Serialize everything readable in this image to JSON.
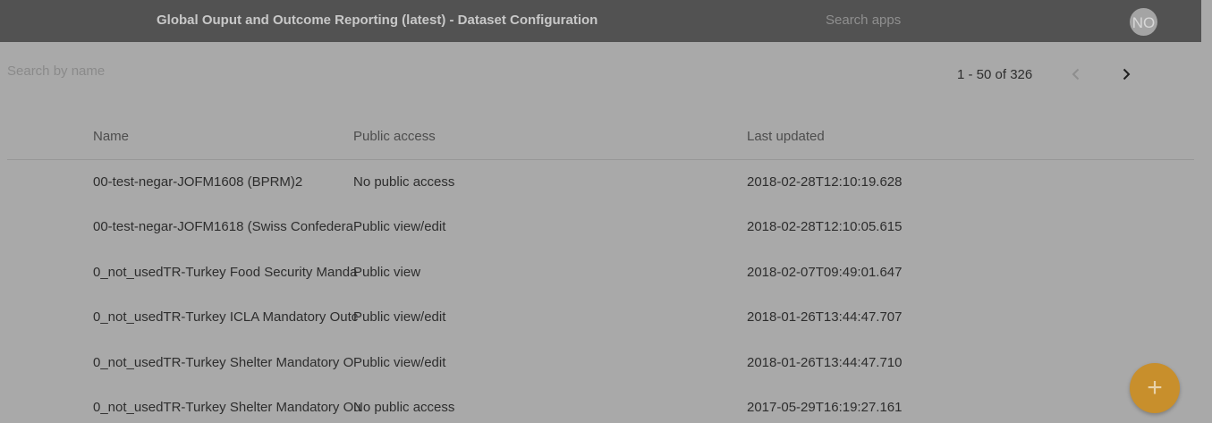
{
  "header": {
    "title": "Global Ouput and Outcome Reporting (latest) - Dataset Configuration",
    "search_placeholder": "Search apps",
    "avatar_initials": "NO"
  },
  "toolbar": {
    "search_placeholder": "Search by name",
    "pagination_label": "1 - 50 of 326"
  },
  "table": {
    "columns": [
      "Name",
      "Public access",
      "Last updated"
    ],
    "rows": [
      {
        "name": "00-test-negar-JOFM1608 (BPRM)2",
        "access": "No public access",
        "updated": "2018-02-28T12:10:19.628"
      },
      {
        "name": "00-test-negar-JOFM1618 (Swiss Confedera",
        "access": "Public view/edit",
        "updated": "2018-02-28T12:10:05.615"
      },
      {
        "name": "0_not_usedTR-Turkey Food Security Manda",
        "access": "Public view",
        "updated": "2018-02-07T09:49:01.647"
      },
      {
        "name": "0_not_usedTR-Turkey ICLA Mandatory Outc",
        "access": "Public view/edit",
        "updated": "2018-01-26T13:44:47.707"
      },
      {
        "name": "0_not_usedTR-Turkey Shelter Mandatory O",
        "access": "Public view/edit",
        "updated": "2018-01-26T13:44:47.710"
      },
      {
        "name": "0_not_usedTR-Turkey Shelter Mandatory Ou",
        "access": "No public access",
        "updated": "2017-05-29T16:19:27.161"
      }
    ]
  },
  "fab": {
    "label": "+"
  },
  "icons": {
    "prev": "chevron-left-icon",
    "next": "chevron-right-icon",
    "add": "plus-icon"
  },
  "colors": {
    "header_bg": "#525252",
    "overlay_bg": "#a9a9a9",
    "fab_bg": "#c88f2c"
  }
}
